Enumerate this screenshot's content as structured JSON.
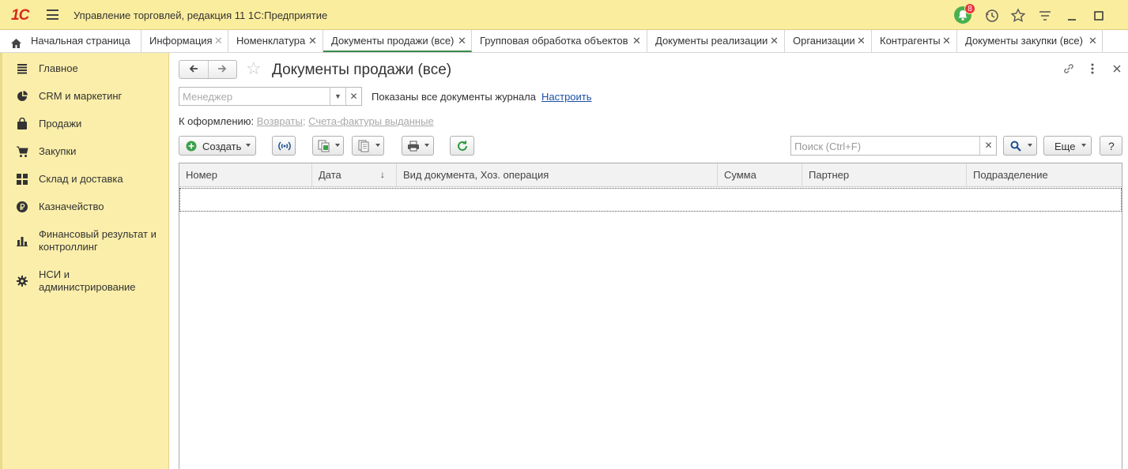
{
  "app": {
    "logo": "1С",
    "title": "Управление торговлей, редакция 11 1С:Предприятие",
    "notifications_count": "8"
  },
  "tabs": [
    {
      "label": "Начальная страница"
    },
    {
      "label": "Информация"
    },
    {
      "label": "Номенклатура"
    },
    {
      "label": "Документы продажи (все)"
    },
    {
      "label": "Групповая обработка объектов"
    },
    {
      "label": "Документы реализации"
    },
    {
      "label": "Организации"
    },
    {
      "label": "Контрагенты"
    },
    {
      "label": "Документы закупки (все)"
    }
  ],
  "sidebar": {
    "items": [
      {
        "label": "Главное",
        "icon": "list-icon"
      },
      {
        "label": "CRM и маркетинг",
        "icon": "pie-chart-icon"
      },
      {
        "label": "Продажи",
        "icon": "bag-icon"
      },
      {
        "label": "Закупки",
        "icon": "cart-icon"
      },
      {
        "label": "Склад и доставка",
        "icon": "grid-icon"
      },
      {
        "label": "Казначейство",
        "icon": "ruble-icon"
      },
      {
        "label": "Финансовый результат и",
        "label2": "контроллинг",
        "icon": "bar-chart-icon"
      },
      {
        "label": "НСИ и",
        "label2": "администрирование",
        "icon": "gear-icon"
      }
    ]
  },
  "form": {
    "title": "Документы продажи (все)",
    "manager_placeholder": "Менеджер",
    "shown_text": "Показаны все документы журнала",
    "setup_link": "Настроить",
    "to_form_label": "К оформлению:",
    "to_form_links": [
      "Возвраты",
      "Счета-фактуры выданные"
    ],
    "separator": ";",
    "create_label": "Создать",
    "search_placeholder": "Поиск (Ctrl+F)",
    "more_label": "Еще",
    "help_label": "?"
  },
  "table": {
    "columns": [
      "Номер",
      "Дата",
      "Вид документа, Хоз. операция",
      "Сумма",
      "Партнер",
      "Подразделение"
    ],
    "sort_indicator": "↓",
    "rows": []
  },
  "colors": {
    "titlebar": "#fbed9e",
    "sidebar": "#fbeeaa",
    "accent_green": "#3a8a4a",
    "link_blue": "#1b4fa5",
    "logo_red": "#d52b1e"
  }
}
